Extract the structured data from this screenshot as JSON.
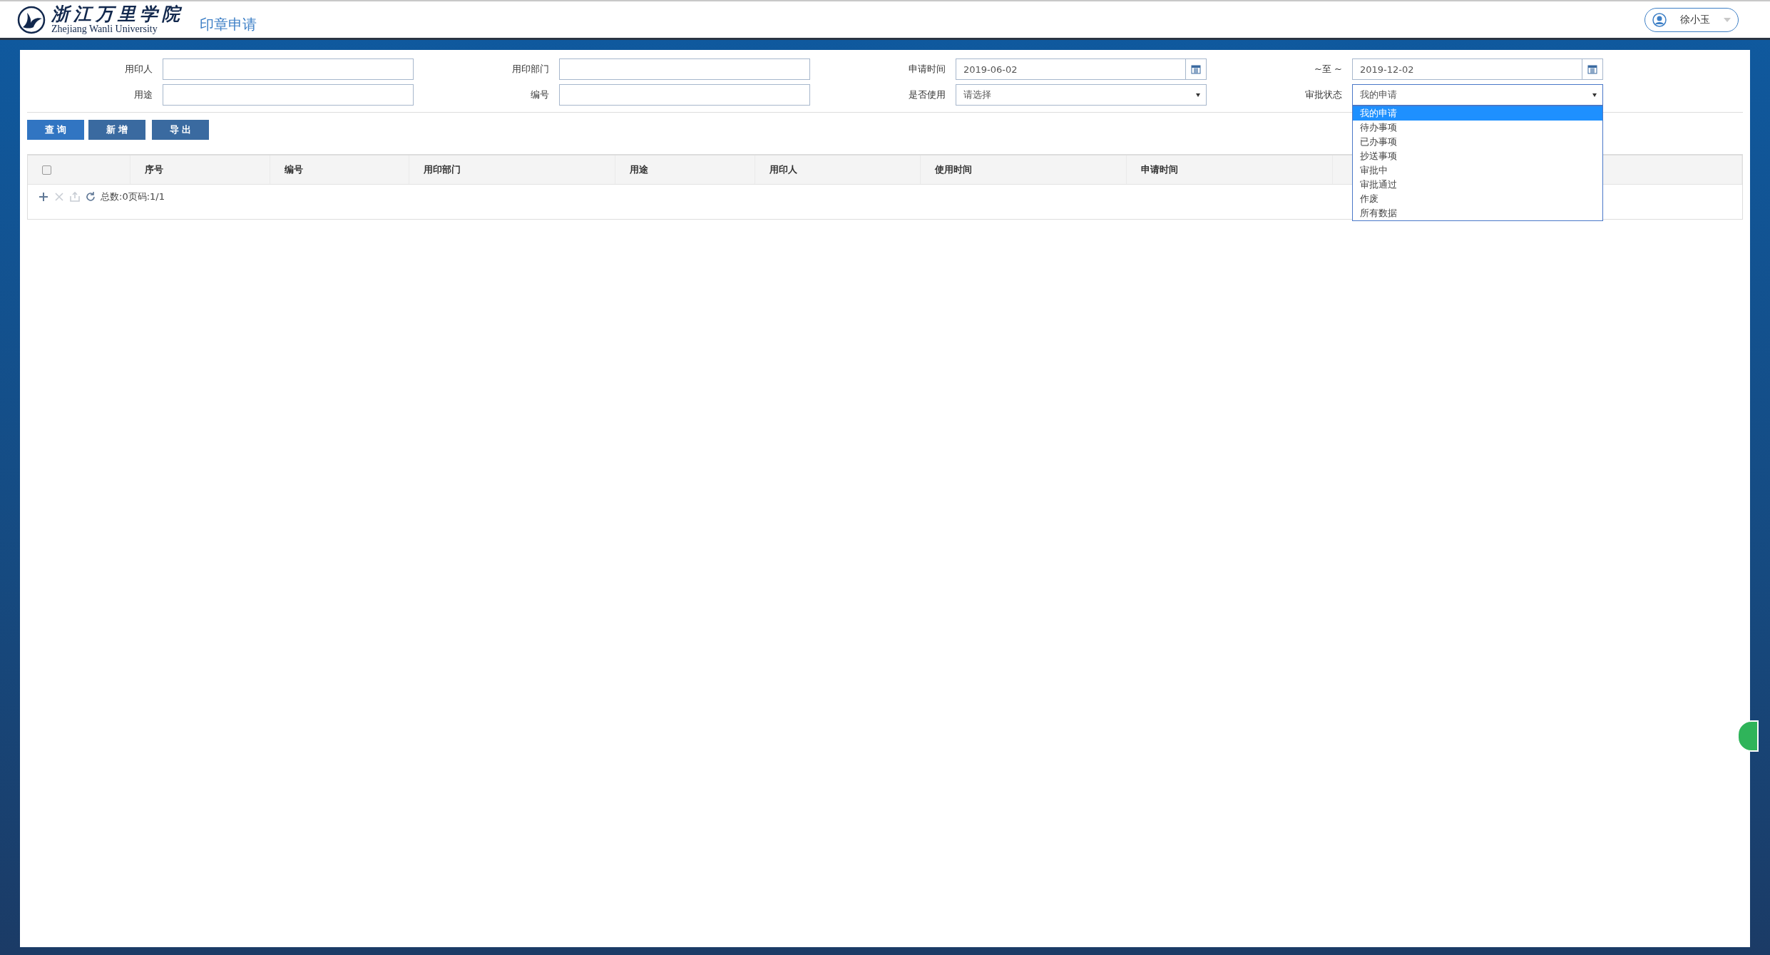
{
  "header": {
    "logo": {
      "name_cn": "浙江万里学院",
      "name_en": "Zhejiang Wanli University"
    },
    "page_title": "印章申请",
    "user": {
      "name": "徐小玉"
    }
  },
  "filters": [
    {
      "label": "用印人",
      "kind": "text"
    },
    {
      "label": "用印部门",
      "kind": "text"
    },
    {
      "label": "申请时间",
      "kind": "date",
      "value": "2019-06-02"
    },
    {
      "label": "~至 ~",
      "kind": "date",
      "value": "2019-12-02"
    },
    {
      "label": "用途",
      "kind": "text"
    },
    {
      "label": "编号",
      "kind": "text"
    },
    {
      "label": "是否使用",
      "kind": "select",
      "value": "请选择",
      "expanded": false
    },
    {
      "label": "审批状态",
      "kind": "select",
      "value": "我的申请",
      "expanded": true,
      "options": [
        {
          "label": "我的申请",
          "selected": true
        },
        {
          "label": "待办事项",
          "selected": false
        },
        {
          "label": "已办事项",
          "selected": false
        },
        {
          "label": "抄送事项",
          "selected": false
        },
        {
          "label": "审批中",
          "selected": false
        },
        {
          "label": "审批通过",
          "selected": false
        },
        {
          "label": "作废",
          "selected": false
        },
        {
          "label": "所有数据",
          "selected": false
        }
      ]
    }
  ],
  "buttons": [
    {
      "label": "查 询",
      "kind": "primary"
    },
    {
      "label": "新 增",
      "kind": "secondary"
    },
    {
      "label": "导 出",
      "kind": "secondary"
    }
  ],
  "table": {
    "select_all": {
      "checked": false
    },
    "columns": [
      "序号",
      "编号",
      "用印部门",
      "用途",
      "用印人",
      "使用时间",
      "申请时间"
    ],
    "toolbar": [
      {
        "kind": "add",
        "disabled": false
      },
      {
        "kind": "delete",
        "disabled": true
      },
      {
        "kind": "export",
        "disabled": true
      },
      {
        "kind": "refresh",
        "disabled": false
      }
    ],
    "summary": "总数:0页码:1/1"
  }
}
